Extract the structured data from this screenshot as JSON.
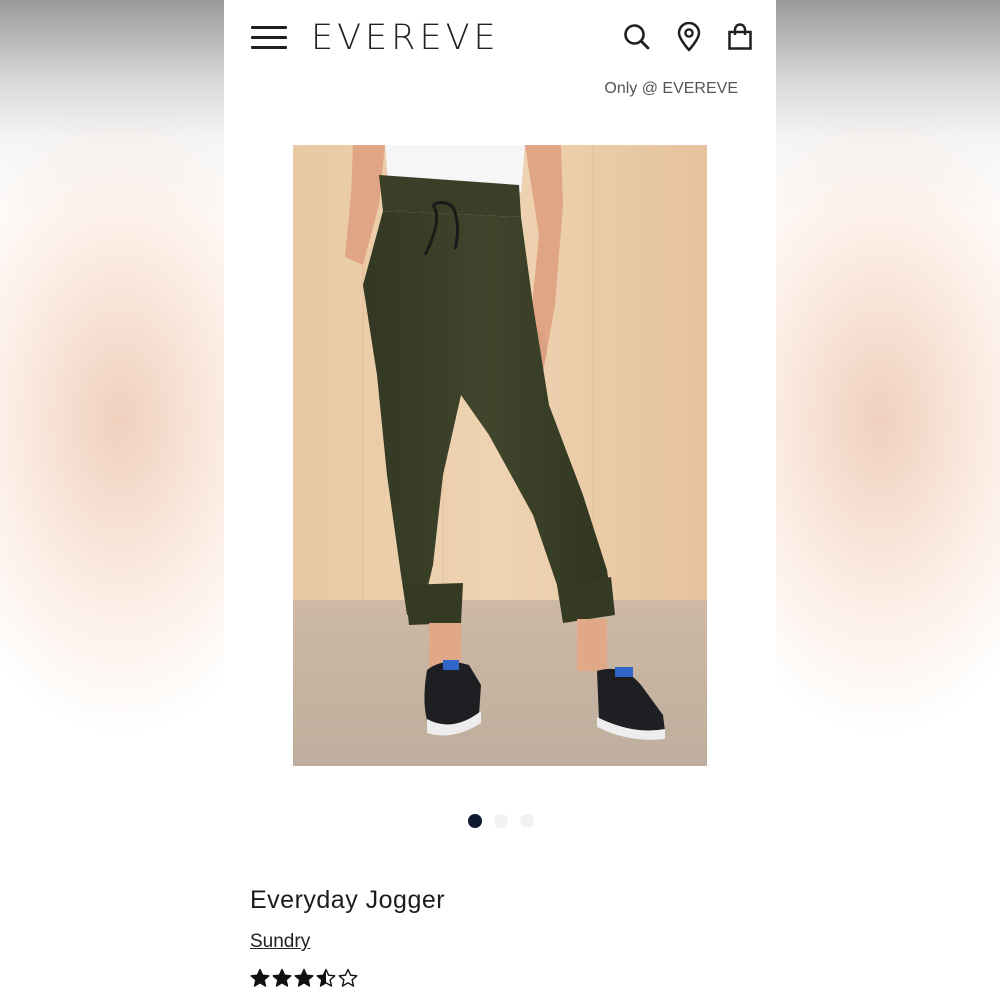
{
  "header": {
    "logo": "EVEREVE",
    "icons": [
      "hamburger-menu-icon",
      "search-icon",
      "location-pin-icon",
      "shopping-bag-icon"
    ]
  },
  "badge": {
    "text": "Only @ EVEREVE"
  },
  "gallery": {
    "image_count": 3,
    "active_index": 0
  },
  "product": {
    "name": "Everyday Jogger",
    "brand": "Sundry",
    "rating": 3.5,
    "rating_max": 5
  },
  "colors": {
    "text": "#1c1c1c",
    "active_dot": "#0e1830",
    "inactive_dot": "#f2f2f2",
    "pants": "#3b4128"
  }
}
